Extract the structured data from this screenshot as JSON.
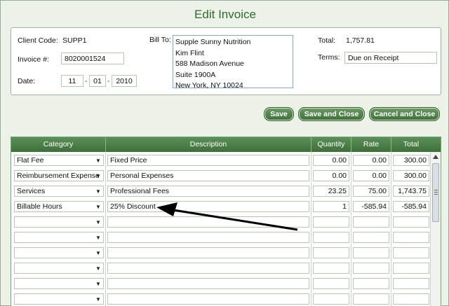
{
  "title": "Edit Invoice",
  "header": {
    "client_code_label": "Client Code:",
    "client_code": "SUPP1",
    "invoice_label": "Invoice #:",
    "invoice_number": "8020001524",
    "date_label": "Date:",
    "date_month": "11",
    "date_day": "01",
    "date_year": "2010",
    "date_sep": "-",
    "bill_to_label": "Bill To:",
    "bill_to_lines": [
      "Supple Sunny Nutrition",
      "Kim Flint",
      "588 Madison Avenue",
      "Suite 1900A",
      "New York, NY  10024"
    ],
    "total_label": "Total:",
    "total_value": "1,757.81",
    "terms_label": "Terms:",
    "terms_value": "Due on Receipt"
  },
  "buttons": {
    "save": "Save",
    "save_close": "Save and Close",
    "cancel_close": "Cancel and Close"
  },
  "grid": {
    "columns": [
      "Category",
      "Description",
      "Quantity",
      "Rate",
      "Total"
    ],
    "rows": [
      {
        "category": "Flat Fee",
        "description": "Fixed Price",
        "quantity": "0.00",
        "rate": "0.00",
        "total": "300.00"
      },
      {
        "category": "Reimbursement Expense",
        "description": "Personal Expenses",
        "quantity": "0.00",
        "rate": "0.00",
        "total": "300.00"
      },
      {
        "category": "Services",
        "description": "Professional Fees",
        "quantity": "23.25",
        "rate": "75.00",
        "total": "1,743.75"
      },
      {
        "category": "Billable Hours",
        "description": "25% Discount",
        "quantity": "1",
        "rate": "-585.94",
        "total": "-585.94"
      },
      {
        "category": "",
        "description": "",
        "quantity": "",
        "rate": "",
        "total": ""
      },
      {
        "category": "",
        "description": "",
        "quantity": "",
        "rate": "",
        "total": ""
      },
      {
        "category": "",
        "description": "",
        "quantity": "",
        "rate": "",
        "total": ""
      },
      {
        "category": "",
        "description": "",
        "quantity": "",
        "rate": "",
        "total": ""
      },
      {
        "category": "",
        "description": "",
        "quantity": "",
        "rate": "",
        "total": ""
      },
      {
        "category": "",
        "description": "",
        "quantity": "",
        "rate": "",
        "total": ""
      }
    ]
  },
  "icons": {
    "dropdown": "chevron-down-icon",
    "scroll_up": "scroll-up-icon",
    "annotation_arrow": "arrow-icon"
  },
  "colors": {
    "accent": "#3e6f3a",
    "title": "#2f6a2f"
  }
}
